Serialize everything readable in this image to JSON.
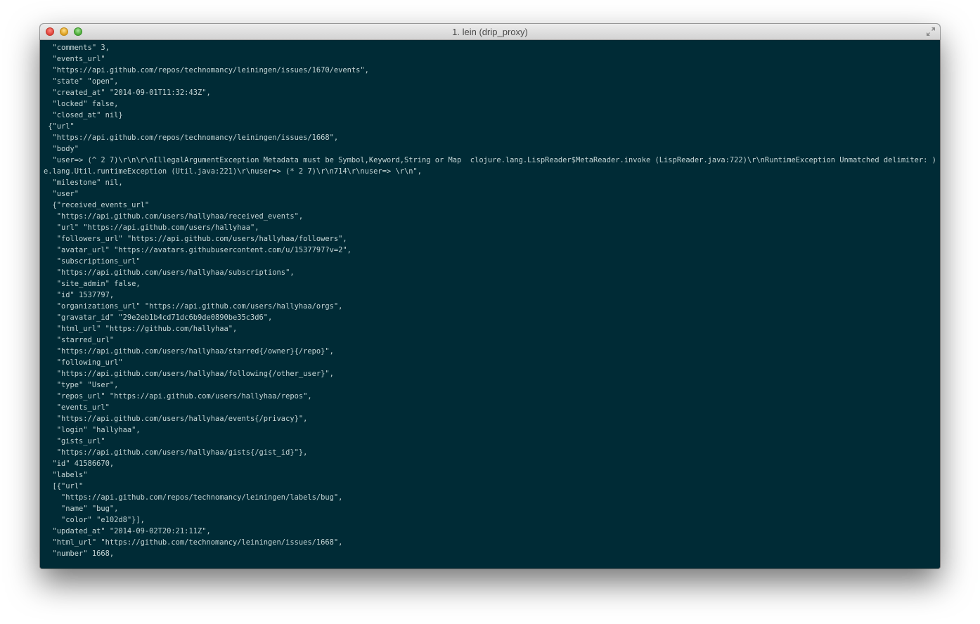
{
  "window": {
    "title": "1. lein (drip_proxy)"
  },
  "colors": {
    "terminal_bg": "#002b36",
    "terminal_fg": "#c4d6d6"
  },
  "terminal": {
    "lines": [
      "  \"comments\" 3,",
      "  \"events_url\"",
      "  \"https://api.github.com/repos/technomancy/leiningen/issues/1670/events\",",
      "  \"state\" \"open\",",
      "  \"created_at\" \"2014-09-01T11:32:43Z\",",
      "  \"locked\" false,",
      "  \"closed_at\" nil}",
      " {\"url\"",
      "  \"https://api.github.com/repos/technomancy/leiningen/issues/1668\",",
      "  \"body\"",
      "  \"user=> (^ 2 7)\\r\\n\\r\\nIllegalArgumentException Metadata must be Symbol,Keyword,String or Map  clojure.lang.LispReader$MetaReader.invoke (LispReader.java:722)\\r\\nRuntimeException Unmatched delimiter: )  clojur",
      "e.lang.Util.runtimeException (Util.java:221)\\r\\nuser=> (* 2 7)\\r\\n714\\r\\nuser=> \\r\\n\",",
      "  \"milestone\" nil,",
      "  \"user\"",
      "  {\"received_events_url\"",
      "   \"https://api.github.com/users/hallyhaa/received_events\",",
      "   \"url\" \"https://api.github.com/users/hallyhaa\",",
      "   \"followers_url\" \"https://api.github.com/users/hallyhaa/followers\",",
      "   \"avatar_url\" \"https://avatars.githubusercontent.com/u/1537797?v=2\",",
      "   \"subscriptions_url\"",
      "   \"https://api.github.com/users/hallyhaa/subscriptions\",",
      "   \"site_admin\" false,",
      "   \"id\" 1537797,",
      "   \"organizations_url\" \"https://api.github.com/users/hallyhaa/orgs\",",
      "   \"gravatar_id\" \"29e2eb1b4cd71dc6b9de0890be35c3d6\",",
      "   \"html_url\" \"https://github.com/hallyhaa\",",
      "   \"starred_url\"",
      "   \"https://api.github.com/users/hallyhaa/starred{/owner}{/repo}\",",
      "   \"following_url\"",
      "   \"https://api.github.com/users/hallyhaa/following{/other_user}\",",
      "   \"type\" \"User\",",
      "   \"repos_url\" \"https://api.github.com/users/hallyhaa/repos\",",
      "   \"events_url\"",
      "   \"https://api.github.com/users/hallyhaa/events{/privacy}\",",
      "   \"login\" \"hallyhaa\",",
      "   \"gists_url\"",
      "   \"https://api.github.com/users/hallyhaa/gists{/gist_id}\"},",
      "  \"id\" 41586670,",
      "  \"labels\"",
      "  [{\"url\"",
      "    \"https://api.github.com/repos/technomancy/leiningen/labels/bug\",",
      "    \"name\" \"bug\",",
      "    \"color\" \"e102d8\"}],",
      "  \"updated_at\" \"2014-09-02T20:21:11Z\",",
      "  \"html_url\" \"https://github.com/technomancy/leiningen/issues/1668\",",
      "  \"number\" 1668,"
    ]
  }
}
